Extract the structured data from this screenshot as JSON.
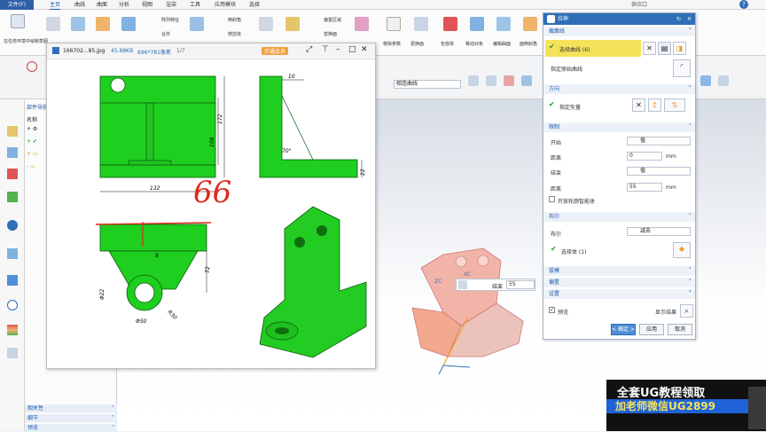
{
  "menubar": {
    "file": "文件(F)",
    "items": [
      "主页",
      "曲线",
      "曲面",
      "分析",
      "视图",
      "渲染",
      "工具",
      "应用模块",
      "选择"
    ],
    "search": "供应口"
  },
  "ribbon": {
    "group_left": "在任务环境中绘制草图",
    "features": [
      "阵列特征",
      "合并",
      "倒斜角",
      "修剪体",
      "拆分体"
    ],
    "sync": [
      "偏置区域",
      "替换面",
      "移动面"
    ],
    "right_buttons": [
      "移除参数",
      "更换面",
      "包容体",
      "移动对象",
      "编辑曲面",
      "面倒斜角"
    ],
    "tab_active": "主页"
  },
  "toolbar2": {
    "filter_select": "相连曲线"
  },
  "nav": {
    "title": "部件导航",
    "col_header": "名称",
    "bottom": [
      "相关性",
      "细节",
      "预览"
    ]
  },
  "viewer": {
    "title": "166702...85.jpg",
    "size": "45.88KB",
    "dims": "696*781像素",
    "page": "1/7",
    "member": "开通会员",
    "dim_labels": {
      "d10": "10",
      "d108": "108",
      "d172": "172",
      "d132": "132",
      "d22": "22",
      "d70": "70°",
      "d8": "8",
      "d72": "72",
      "phi22": "Φ22",
      "phi50": "Φ50",
      "r30": "R30"
    },
    "handwritten": "66"
  },
  "dialog": {
    "title": "拉伸",
    "section_profile": "截面线",
    "select_curve": "选择曲线 (6)",
    "specify_origin": "指定原始曲线",
    "section_direction": "方向",
    "specify_vector": "指定矢量",
    "section_limits": "限制",
    "start_label": "开始",
    "start_value": "值",
    "distance_label": "距离",
    "start_distance": "0",
    "unit": "mm",
    "end_label": "结束",
    "end_value": "值",
    "end_distance": "55",
    "open_profile": "开放轮廓智能体",
    "section_bool": "布尔",
    "bool_label": "布尔",
    "bool_value": "减去",
    "select_body": "选择体 (1)",
    "section_draft": "拔模",
    "section_offset": "偏置",
    "section_settings": "设置",
    "preview": "预览",
    "show_result": "显示结果",
    "ok": "< 确定 >",
    "apply": "应用",
    "cancel": "取消"
  },
  "tip": {
    "label": "结束",
    "value": "55"
  },
  "axis": {
    "zc": "ZC",
    "xc": "XC"
  },
  "promo": {
    "line1": "全套UG教程领取",
    "line2": "加老师微信UG2899"
  },
  "colors": {
    "accent": "#2f6fb8",
    "part_green": "#22cc22",
    "preview_pink": "#f0a79a",
    "orange": "#f39c1e"
  }
}
